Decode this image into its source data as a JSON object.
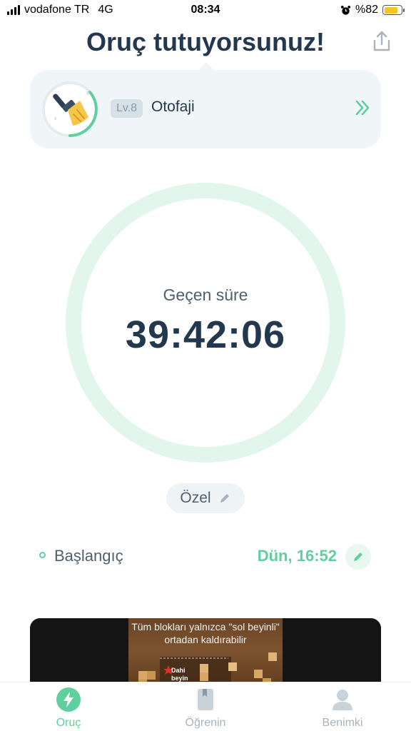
{
  "status_bar": {
    "carrier": "vodafone TR",
    "network": "4G",
    "time": "08:34",
    "battery": "%82",
    "battery_level": 0.82
  },
  "header": {
    "title": "Oruç tutuyorsunuz!",
    "share_icon": "share-icon"
  },
  "stage": {
    "level": "Lv.8",
    "name": "Otofaji",
    "icon": "broom-icon",
    "arrow_icon": "double-chevron-right-icon"
  },
  "timer": {
    "label": "Geçen süre",
    "value": "39:42:06"
  },
  "mode": {
    "label": "Özel",
    "icon": "pencil-icon"
  },
  "start": {
    "label": "Başlangıç",
    "value": "Dün, 16:52",
    "icon": "pencil-icon"
  },
  "ad": {
    "line1": "Tüm blokları yalnızca \"sol beyinli\"",
    "line2": "ortadan kaldırabilir",
    "badge": "Dahi beyin"
  },
  "tabs": [
    {
      "label": "Oruç",
      "icon": "lightning-icon",
      "active": true
    },
    {
      "label": "Öğrenin",
      "icon": "book-icon",
      "active": false
    },
    {
      "label": "Benimki",
      "icon": "profile-icon",
      "active": false
    }
  ],
  "colors": {
    "accent": "#5fcf9f",
    "title": "#23384f",
    "ring": "#e3f6ee",
    "card_bg": "#f0f6f8"
  }
}
